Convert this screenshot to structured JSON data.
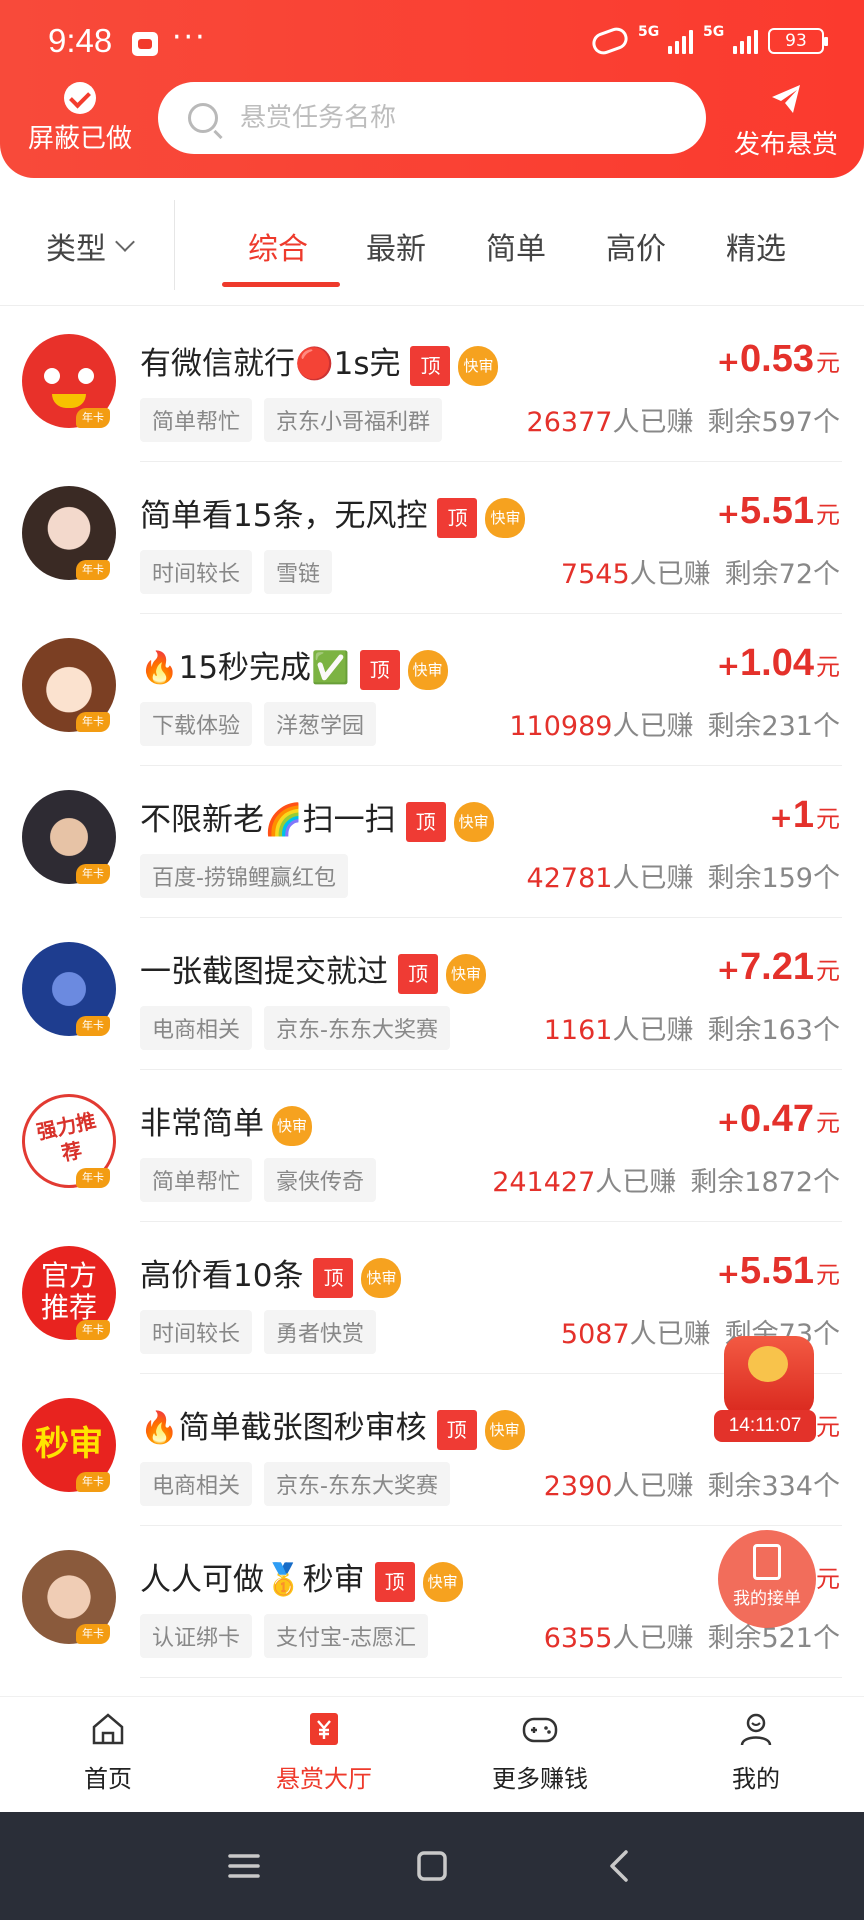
{
  "status": {
    "time": "9:48",
    "dots": "···",
    "network1": "5G",
    "network2": "5G",
    "battery": "93"
  },
  "header": {
    "hide_done_label": "屏蔽已做",
    "search_placeholder": "悬赏任务名称",
    "publish_label": "发布悬赏",
    "colors": {
      "brand": "#f84a3a",
      "accent": "#ee3a2c",
      "price": "#e4312b"
    }
  },
  "filters": {
    "type_label": "类型",
    "tabs": [
      "综合",
      "最新",
      "简单",
      "高价",
      "精选"
    ],
    "active_tab": "综合"
  },
  "common": {
    "top_badge": "顶",
    "fast_badge": "快审",
    "year_badge": "年卡",
    "earned_suffix": "人已赚",
    "remaining_prefix": "剩余",
    "remaining_suffix": "个",
    "currency": "元"
  },
  "tasks": [
    {
      "title": "有微信就行🔴1s完",
      "top": true,
      "fast": true,
      "price": "0.53",
      "tags": [
        "简单帮忙",
        "京东小哥福利群"
      ],
      "earned": "26377",
      "remaining": "597"
    },
    {
      "title": "简单看15条，无风控",
      "top": true,
      "fast": true,
      "price": "5.51",
      "tags": [
        "时间较长",
        "雪链"
      ],
      "earned": "7545",
      "remaining": "72"
    },
    {
      "title": "🔥15秒完成✅",
      "top": true,
      "fast": true,
      "price": "1.04",
      "tags": [
        "下载体验",
        "洋葱学园"
      ],
      "earned": "110989",
      "remaining": "231"
    },
    {
      "title": "不限新老🌈扫一扫",
      "top": true,
      "fast": true,
      "price": "1",
      "tags": [
        "百度-捞锦鲤赢红包"
      ],
      "earned": "42781",
      "remaining": "159"
    },
    {
      "title": "一张截图提交就过",
      "top": true,
      "fast": true,
      "price": "7.21",
      "tags": [
        "电商相关",
        "京东-东东大奖赛"
      ],
      "earned": "1161",
      "remaining": "163"
    },
    {
      "title": "非常简单",
      "top": false,
      "fast": true,
      "price": "0.47",
      "tags": [
        "简单帮忙",
        "豪侠传奇"
      ],
      "earned": "241427",
      "remaining": "1872"
    },
    {
      "title": "高价看10条",
      "top": true,
      "fast": true,
      "price": "5.51",
      "tags": [
        "时间较长",
        "勇者快赏"
      ],
      "earned": "5087",
      "remaining": "73"
    },
    {
      "title": "🔥简单截张图秒审核",
      "top": true,
      "fast": true,
      "price": "",
      "tags": [
        "电商相关",
        "京东-东东大奖赛"
      ],
      "earned": "2390",
      "remaining": "334"
    },
    {
      "title": "人人可做🥇秒审",
      "top": true,
      "fast": true,
      "price": "",
      "tags": [
        "认证绑卡",
        "支付宝-志愿汇"
      ],
      "earned": "6355",
      "remaining": "521"
    }
  ],
  "avatar_text": {
    "a6": "强力推荐",
    "a7": "官方推荐",
    "a8": "秒审"
  },
  "floating": {
    "timer": "14:11:07",
    "my_orders": "我的接单"
  },
  "bottom_nav": [
    {
      "label": "首页",
      "icon": "home-icon"
    },
    {
      "label": "悬赏大厅",
      "icon": "yuan-hall-icon",
      "active": true
    },
    {
      "label": "更多赚钱",
      "icon": "gamepad-icon"
    },
    {
      "label": "我的",
      "icon": "user-icon"
    }
  ]
}
